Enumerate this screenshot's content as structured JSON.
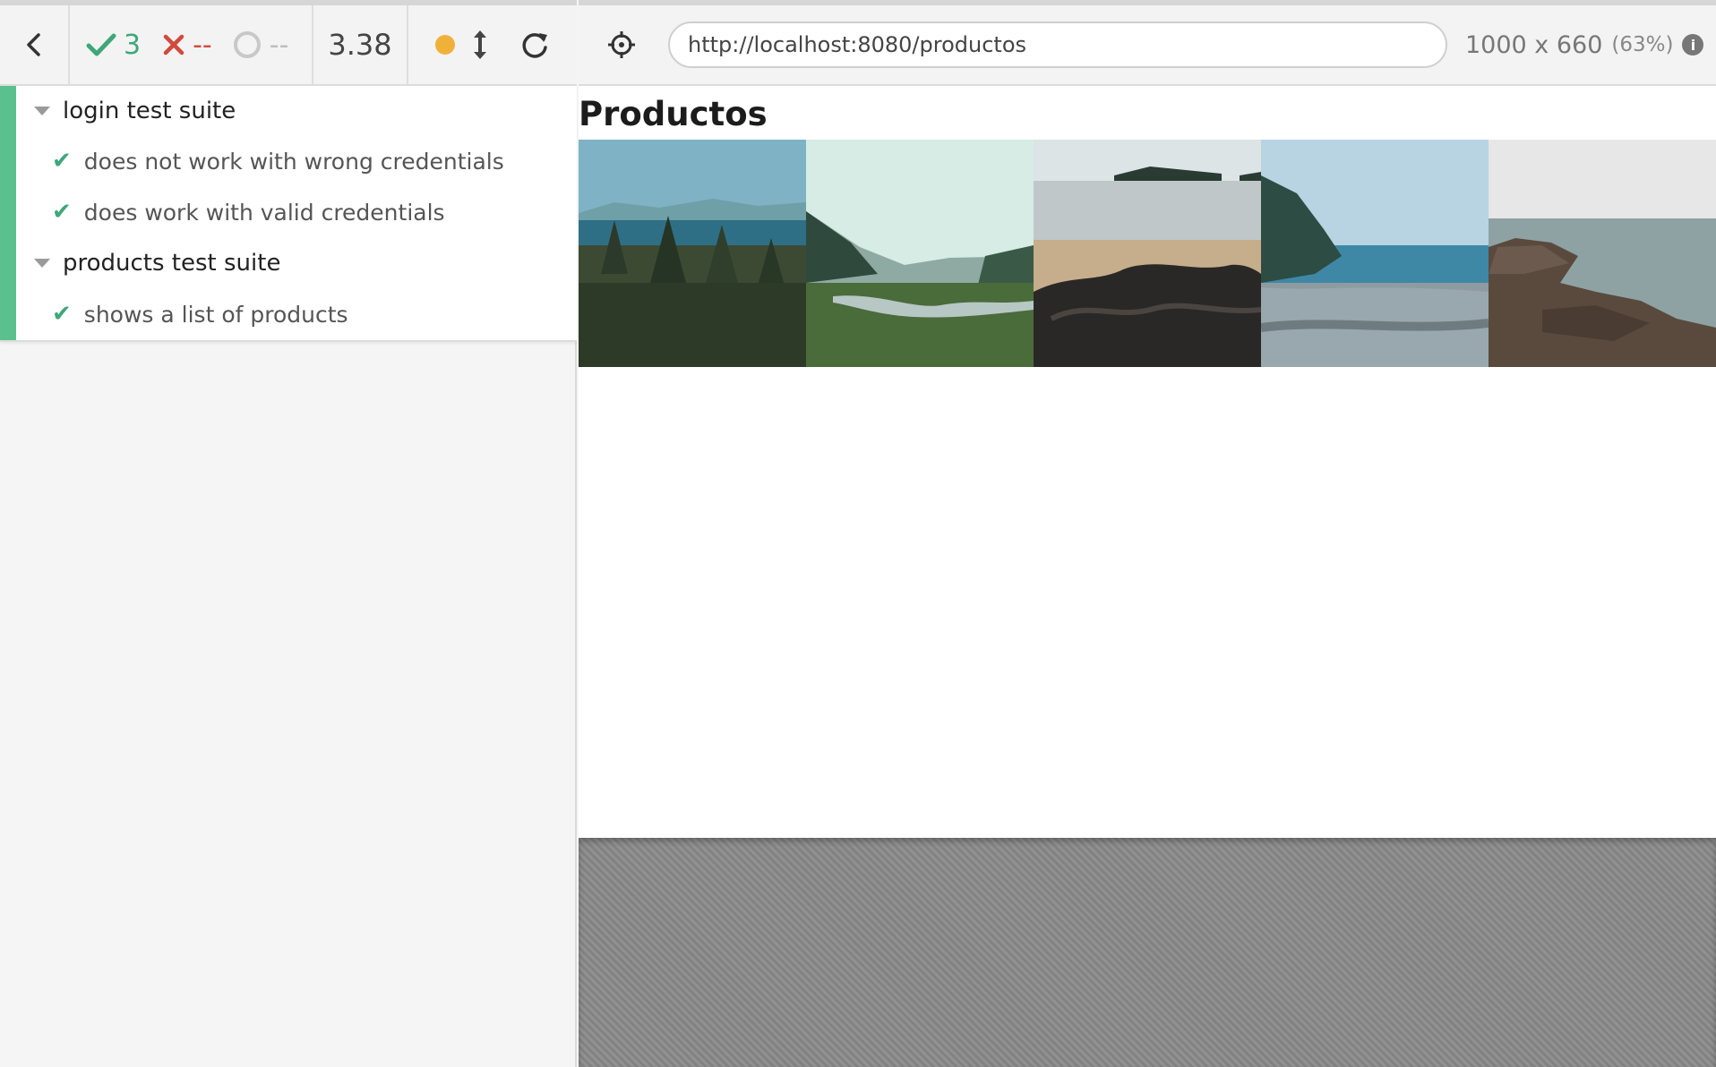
{
  "reporter": {
    "back_icon": "chevron-left-icon",
    "stats": {
      "passed": "3",
      "failed": "--",
      "pending": "--"
    },
    "duration": "3.38",
    "controls": {
      "status_color": "#f0b13a",
      "scroll_icon": "up-down-arrow-icon",
      "reload_icon": "reload-icon"
    },
    "suites": [
      {
        "title": "login test suite",
        "tests": [
          {
            "title": "does not work with wrong credentials",
            "state": "passed"
          },
          {
            "title": "does work with valid credentials",
            "state": "passed"
          }
        ]
      },
      {
        "title": "products test suite",
        "tests": [
          {
            "title": "shows a list of products",
            "state": "passed"
          }
        ]
      }
    ]
  },
  "aut": {
    "selector_icon": "crosshair-icon",
    "url": "http://localhost:8080/productos",
    "viewport": "1000 x 660",
    "scale": "(63%)",
    "page": {
      "heading": "Productos",
      "images": [
        {
          "name": "forest-lake-photo"
        },
        {
          "name": "river-meadow-photo"
        },
        {
          "name": "beach-rocks-photo"
        },
        {
          "name": "pebble-shore-photo"
        },
        {
          "name": "rocky-coast-photo"
        }
      ]
    }
  },
  "colors": {
    "pass": "#3fa77a",
    "fail": "#d14a3b",
    "stripe": "#5ac18e"
  }
}
